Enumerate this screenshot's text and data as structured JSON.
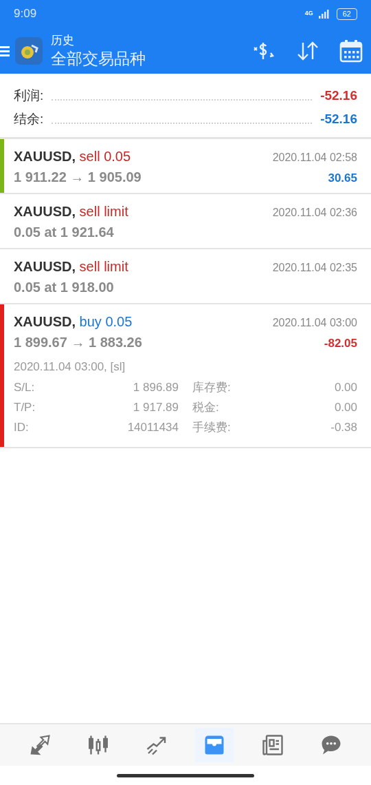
{
  "status_bar": {
    "time": "9:09",
    "network": "4G",
    "battery": "62"
  },
  "header": {
    "subtitle": "历史",
    "title": "全部交易品种"
  },
  "summary": [
    {
      "label": "利润:",
      "value": "-52.16",
      "kind": "loss"
    },
    {
      "label": "结余:",
      "value": "-52.16",
      "kind": "gain"
    }
  ],
  "deals": [
    {
      "symbol": "XAUUSD,",
      "action": "sell 0.05",
      "kind": "sell",
      "time": "2020.11.04 02:58",
      "prices": "1 911.22 → 1 905.09",
      "profit": {
        "value": "30.65",
        "kind": "gain"
      },
      "color": "#7cb518",
      "expanded": false
    },
    {
      "symbol": "XAUUSD,",
      "action": "sell limit",
      "kind": "sell",
      "time": "2020.11.04 02:36",
      "prices": "0.05 at 1 921.64",
      "expanded": false
    },
    {
      "symbol": "XAUUSD,",
      "action": "sell limit",
      "kind": "sell",
      "time": "2020.11.04 02:35",
      "prices": "0.05 at 1 918.00",
      "expanded": false
    },
    {
      "symbol": "XAUUSD,",
      "action": "buy 0.05",
      "kind": "buy",
      "time": "2020.11.04 03:00",
      "prices": "1 899.67 → 1 883.26",
      "profit": {
        "value": "-82.05",
        "kind": "loss"
      },
      "color": "#e0201b",
      "expanded": true,
      "close_info": "2020.11.04 03:00, [sl]",
      "details": [
        {
          "label": "S/L:",
          "value": "1 896.89",
          "label2": "库存费:",
          "value2": "0.00"
        },
        {
          "label": "T/P:",
          "value": "1 917.89",
          "label2": "税金:",
          "value2": "0.00"
        },
        {
          "label": "ID:",
          "value": "14011434",
          "label2": "手续费:",
          "value2": "-0.38"
        }
      ]
    }
  ],
  "bottom_nav": [
    {
      "kind": "quotes",
      "selected": false
    },
    {
      "kind": "chart",
      "selected": false
    },
    {
      "kind": "trade",
      "selected": false
    },
    {
      "kind": "history",
      "selected": true
    },
    {
      "kind": "news",
      "selected": false
    },
    {
      "kind": "chat",
      "selected": false
    }
  ]
}
